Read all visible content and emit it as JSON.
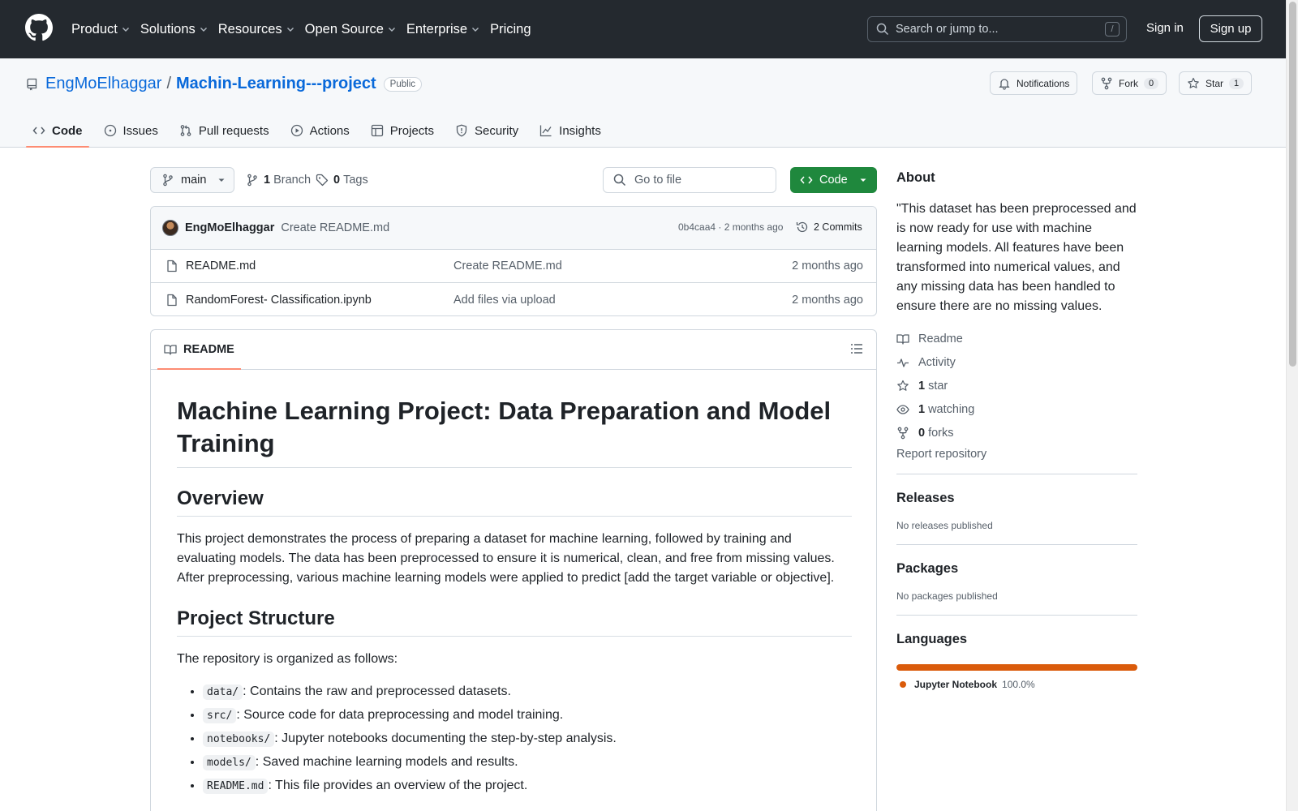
{
  "topbar": {
    "nav": [
      {
        "label": "Product",
        "dropdown": true
      },
      {
        "label": "Solutions",
        "dropdown": true
      },
      {
        "label": "Resources",
        "dropdown": true
      },
      {
        "label": "Open Source",
        "dropdown": true
      },
      {
        "label": "Enterprise",
        "dropdown": true
      },
      {
        "label": "Pricing",
        "dropdown": false
      }
    ],
    "search_placeholder": "Search or jump to...",
    "search_shortcut": "/",
    "signin": "Sign in",
    "signup": "Sign up"
  },
  "repo": {
    "owner": "EngMoElhaggar",
    "separator": "/",
    "name": "Machin-Learning---project",
    "visibility": "Public",
    "notifications_label": "Notifications",
    "fork_label": "Fork",
    "fork_count": "0",
    "star_label": "Star",
    "star_count": "1"
  },
  "tabs": [
    {
      "label": "Code",
      "icon": "code-icon",
      "active": true
    },
    {
      "label": "Issues",
      "icon": "issue-icon"
    },
    {
      "label": "Pull requests",
      "icon": "pull-request-icon"
    },
    {
      "label": "Actions",
      "icon": "play-icon"
    },
    {
      "label": "Projects",
      "icon": "table-icon"
    },
    {
      "label": "Security",
      "icon": "shield-icon"
    },
    {
      "label": "Insights",
      "icon": "graph-icon"
    }
  ],
  "toolbar": {
    "branch": "main",
    "branch_count": "1",
    "branch_label": "Branch",
    "tag_count": "0",
    "tag_label": "Tags",
    "gofile_placeholder": "Go to file",
    "code_label": "Code"
  },
  "commit": {
    "author": "EngMoElhaggar",
    "message": "Create README.md",
    "hash_time": "0b4caa4 · 2 months ago",
    "commits_label": "2 Commits"
  },
  "files": [
    {
      "name": "README.md",
      "message": "Create README.md",
      "date": "2 months ago"
    },
    {
      "name": "RandomForest- Classification.ipynb",
      "message": "Add files via upload",
      "date": "2 months ago"
    }
  ],
  "readme": {
    "tab_label": "README",
    "title": "Machine Learning Project: Data Preparation and Model Training",
    "overview_heading": "Overview",
    "overview_text": "This project demonstrates the process of preparing a dataset for machine learning, followed by training and evaluating models. The data has been preprocessed to ensure it is numerical, clean, and free from missing values. After preprocessing, various machine learning models were applied to predict [add the target variable or objective].",
    "structure_heading": "Project Structure",
    "structure_intro": "The repository is organized as follows:",
    "structure_items": [
      {
        "code": "data/",
        "text": ": Contains the raw and preprocessed datasets."
      },
      {
        "code": "src/",
        "text": ": Source code for data preprocessing and model training."
      },
      {
        "code": "notebooks/",
        "text": ": Jupyter notebooks documenting the step-by-step analysis."
      },
      {
        "code": "models/",
        "text": ": Saved machine learning models and results."
      },
      {
        "code": "README.md",
        "text": ": This file provides an overview of the project."
      }
    ]
  },
  "sidebar": {
    "about_heading": "About",
    "about_text": "\"This dataset has been preprocessed and is now ready for use with machine learning models. All features have been transformed into numerical values, and any missing data has been handled to ensure there are no missing values.",
    "links": [
      {
        "icon": "book-icon",
        "count": "",
        "label": "Readme"
      },
      {
        "icon": "pulse-icon",
        "count": "",
        "label": "Activity"
      },
      {
        "icon": "star-icon",
        "count": "1",
        "label": "star"
      },
      {
        "icon": "eye-icon",
        "count": "1",
        "label": "watching"
      },
      {
        "icon": "fork-icon",
        "count": "0",
        "label": "forks"
      }
    ],
    "report": "Report repository",
    "releases_heading": "Releases",
    "releases_text": "No releases published",
    "packages_heading": "Packages",
    "packages_text": "No packages published",
    "languages_heading": "Languages",
    "languages": [
      {
        "name": "Jupyter Notebook",
        "percent": "100.0%",
        "color": "#DA5B0B"
      }
    ]
  },
  "colors": {
    "header_bg": "#24292f",
    "link": "#0969da",
    "primary_button": "#1f883d",
    "active_tab_underline": "#fd8c73"
  }
}
